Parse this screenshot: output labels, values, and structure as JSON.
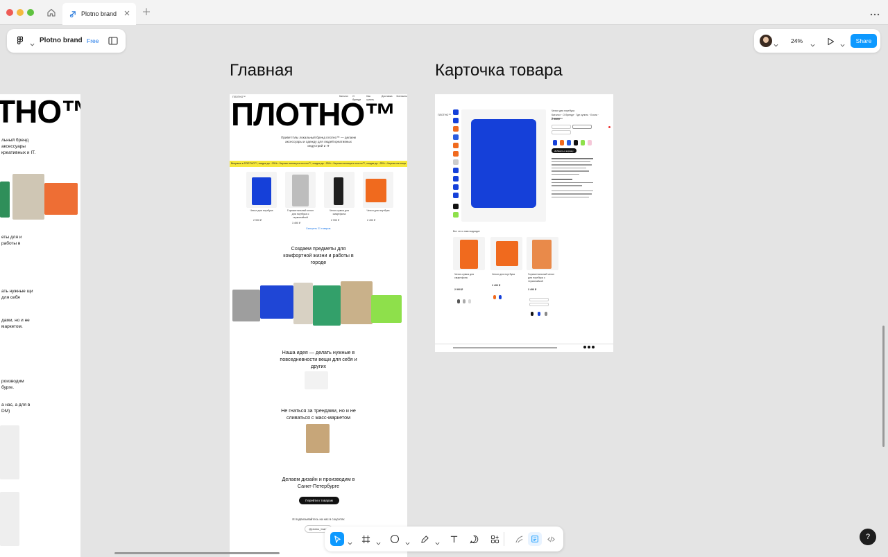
{
  "window": {
    "tab_title": "Plotno brand"
  },
  "file": {
    "name": "Plotno brand",
    "plan": "Free"
  },
  "zoom": "24%",
  "share_label": "Share",
  "help_label": "?",
  "frames": {
    "left": {
      "logo_text": "ТНО™",
      "intro": "льный бренд аксессуары креативных и IT.",
      "s1": "еты для и работы в",
      "s2": "ать нужные щи для себя",
      "s3": "дами, но и не маркетом.",
      "s4": "роизводим бурге.",
      "s5": "а нас, а для в DM)"
    },
    "main": {
      "title": "Главная",
      "logo_text": "ПЛОТНО™",
      "nav": [
        "Каталог",
        "О бренде",
        "Как купить",
        "Доставка",
        "Контакты"
      ],
      "intro": "Привет! Мы локальный бренд плотно™ — делаем аксессуары и одежду для людей креативных индустрий и IT",
      "marquee": "Впервые в ПЛОТНО™, скидка до −25% • Черная пятница в плотно™, скидка до −25% • Черная пятница в плотно™, скидка до −25% • Черная пятница",
      "products": [
        "Чехол для ноутбука",
        "Горизонтальный чехол для ноутбука с термопайкой",
        "Чехол-сумка для смартфона",
        "Чехол для ноутбука"
      ],
      "prices": [
        "2 990 ₽",
        "3 490 ₽",
        "2 990 ₽",
        "2 490 ₽"
      ],
      "more_link": "Смотреть 21 товаров",
      "heading1": "Создаем предметы для комфортной жизни и работы в городе",
      "heading2": "Наша идея — делать нужные в повседневности вещи для себя и других",
      "heading3": "Не гнаться за трендами, но и не сливаться с масс-маркетом",
      "heading4": "Делаем дизайн и производим в Санкт-Петербурге",
      "cta": "Перейти к товарам",
      "subscribe": "И подписывайтесь на нас в соцсетях",
      "handle": "@plotno_brand"
    },
    "product": {
      "title": "Карточка товара",
      "product_name": "Чехол для ноутбука",
      "price": "2 990 ₽",
      "add_to_cart": "Добавить в корзину",
      "recs_title": "Вот что к нам подходит",
      "rec_names": [
        "Чехол-сумка для смартфона",
        "Чехол для ноутбука",
        "Горизонтальный чехол для ноутбука с термопайкой"
      ],
      "rec_prices": [
        "2 990 ₽",
        "2 490 ₽",
        "3 490 ₽"
      ]
    }
  },
  "colors": {
    "accent": "#0d99ff",
    "plan": "#1b76e8",
    "product_blue": "#1540d9",
    "product_orange": "#f06a1e",
    "marquee_yellow": "#f6e83a"
  },
  "toolbar_tools": [
    "move-tool",
    "frame-tool",
    "shape-tool",
    "pen-tool",
    "text-tool",
    "comment-tool",
    "actions-tool",
    "draw-mode",
    "design-mode",
    "dev-mode"
  ]
}
